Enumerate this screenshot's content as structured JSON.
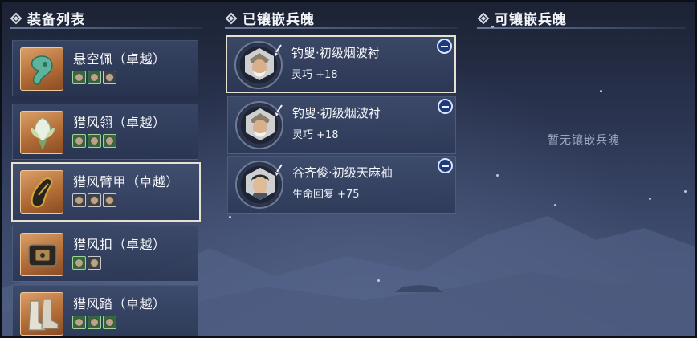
{
  "sections": {
    "equipment_list": "装备列表",
    "inlaid": "已镶嵌兵魄",
    "available": "可镶嵌兵魄"
  },
  "equipment": [
    {
      "name": "悬空佩（卓越）",
      "icon": "jade-pendant-icon",
      "selected": false,
      "slots": [
        "filled",
        "filled",
        "empty"
      ]
    },
    {
      "name": "猎风翎（卓越）",
      "icon": "feather-plume-icon",
      "selected": false,
      "slots": [
        "filled",
        "filled",
        "filled"
      ]
    },
    {
      "name": "猎风臂甲（卓越）",
      "icon": "gauntlet-icon",
      "selected": true,
      "slots": [
        "empty",
        "empty",
        "empty"
      ]
    },
    {
      "name": "猎风扣（卓越）",
      "icon": "belt-buckle-icon",
      "selected": false,
      "slots": [
        "filled",
        "empty"
      ]
    },
    {
      "name": "猎风踏（卓越）",
      "icon": "boots-icon",
      "selected": false,
      "slots": [
        "filled",
        "filled",
        "filled"
      ]
    }
  ],
  "inlaid_souls": [
    {
      "name": "钓叟·初级烟波衬",
      "stat": "灵巧 +18",
      "selected": true,
      "portrait": "old-fisherman-portrait"
    },
    {
      "name": "钓叟·初级烟波衬",
      "stat": "灵巧 +18",
      "selected": false,
      "portrait": "old-fisherman-portrait"
    },
    {
      "name": "谷齐俊·初级天麻袖",
      "stat": "生命回复 +75",
      "selected": false,
      "portrait": "young-man-portrait"
    }
  ],
  "available_empty_text": "暂无镶嵌兵魄",
  "colors": {
    "slot_filled": "#2f6b3b",
    "item_border_selected": "#e6e2cf",
    "remove_button": "#1d3a7a",
    "thumb_bg": "#b36d37"
  }
}
